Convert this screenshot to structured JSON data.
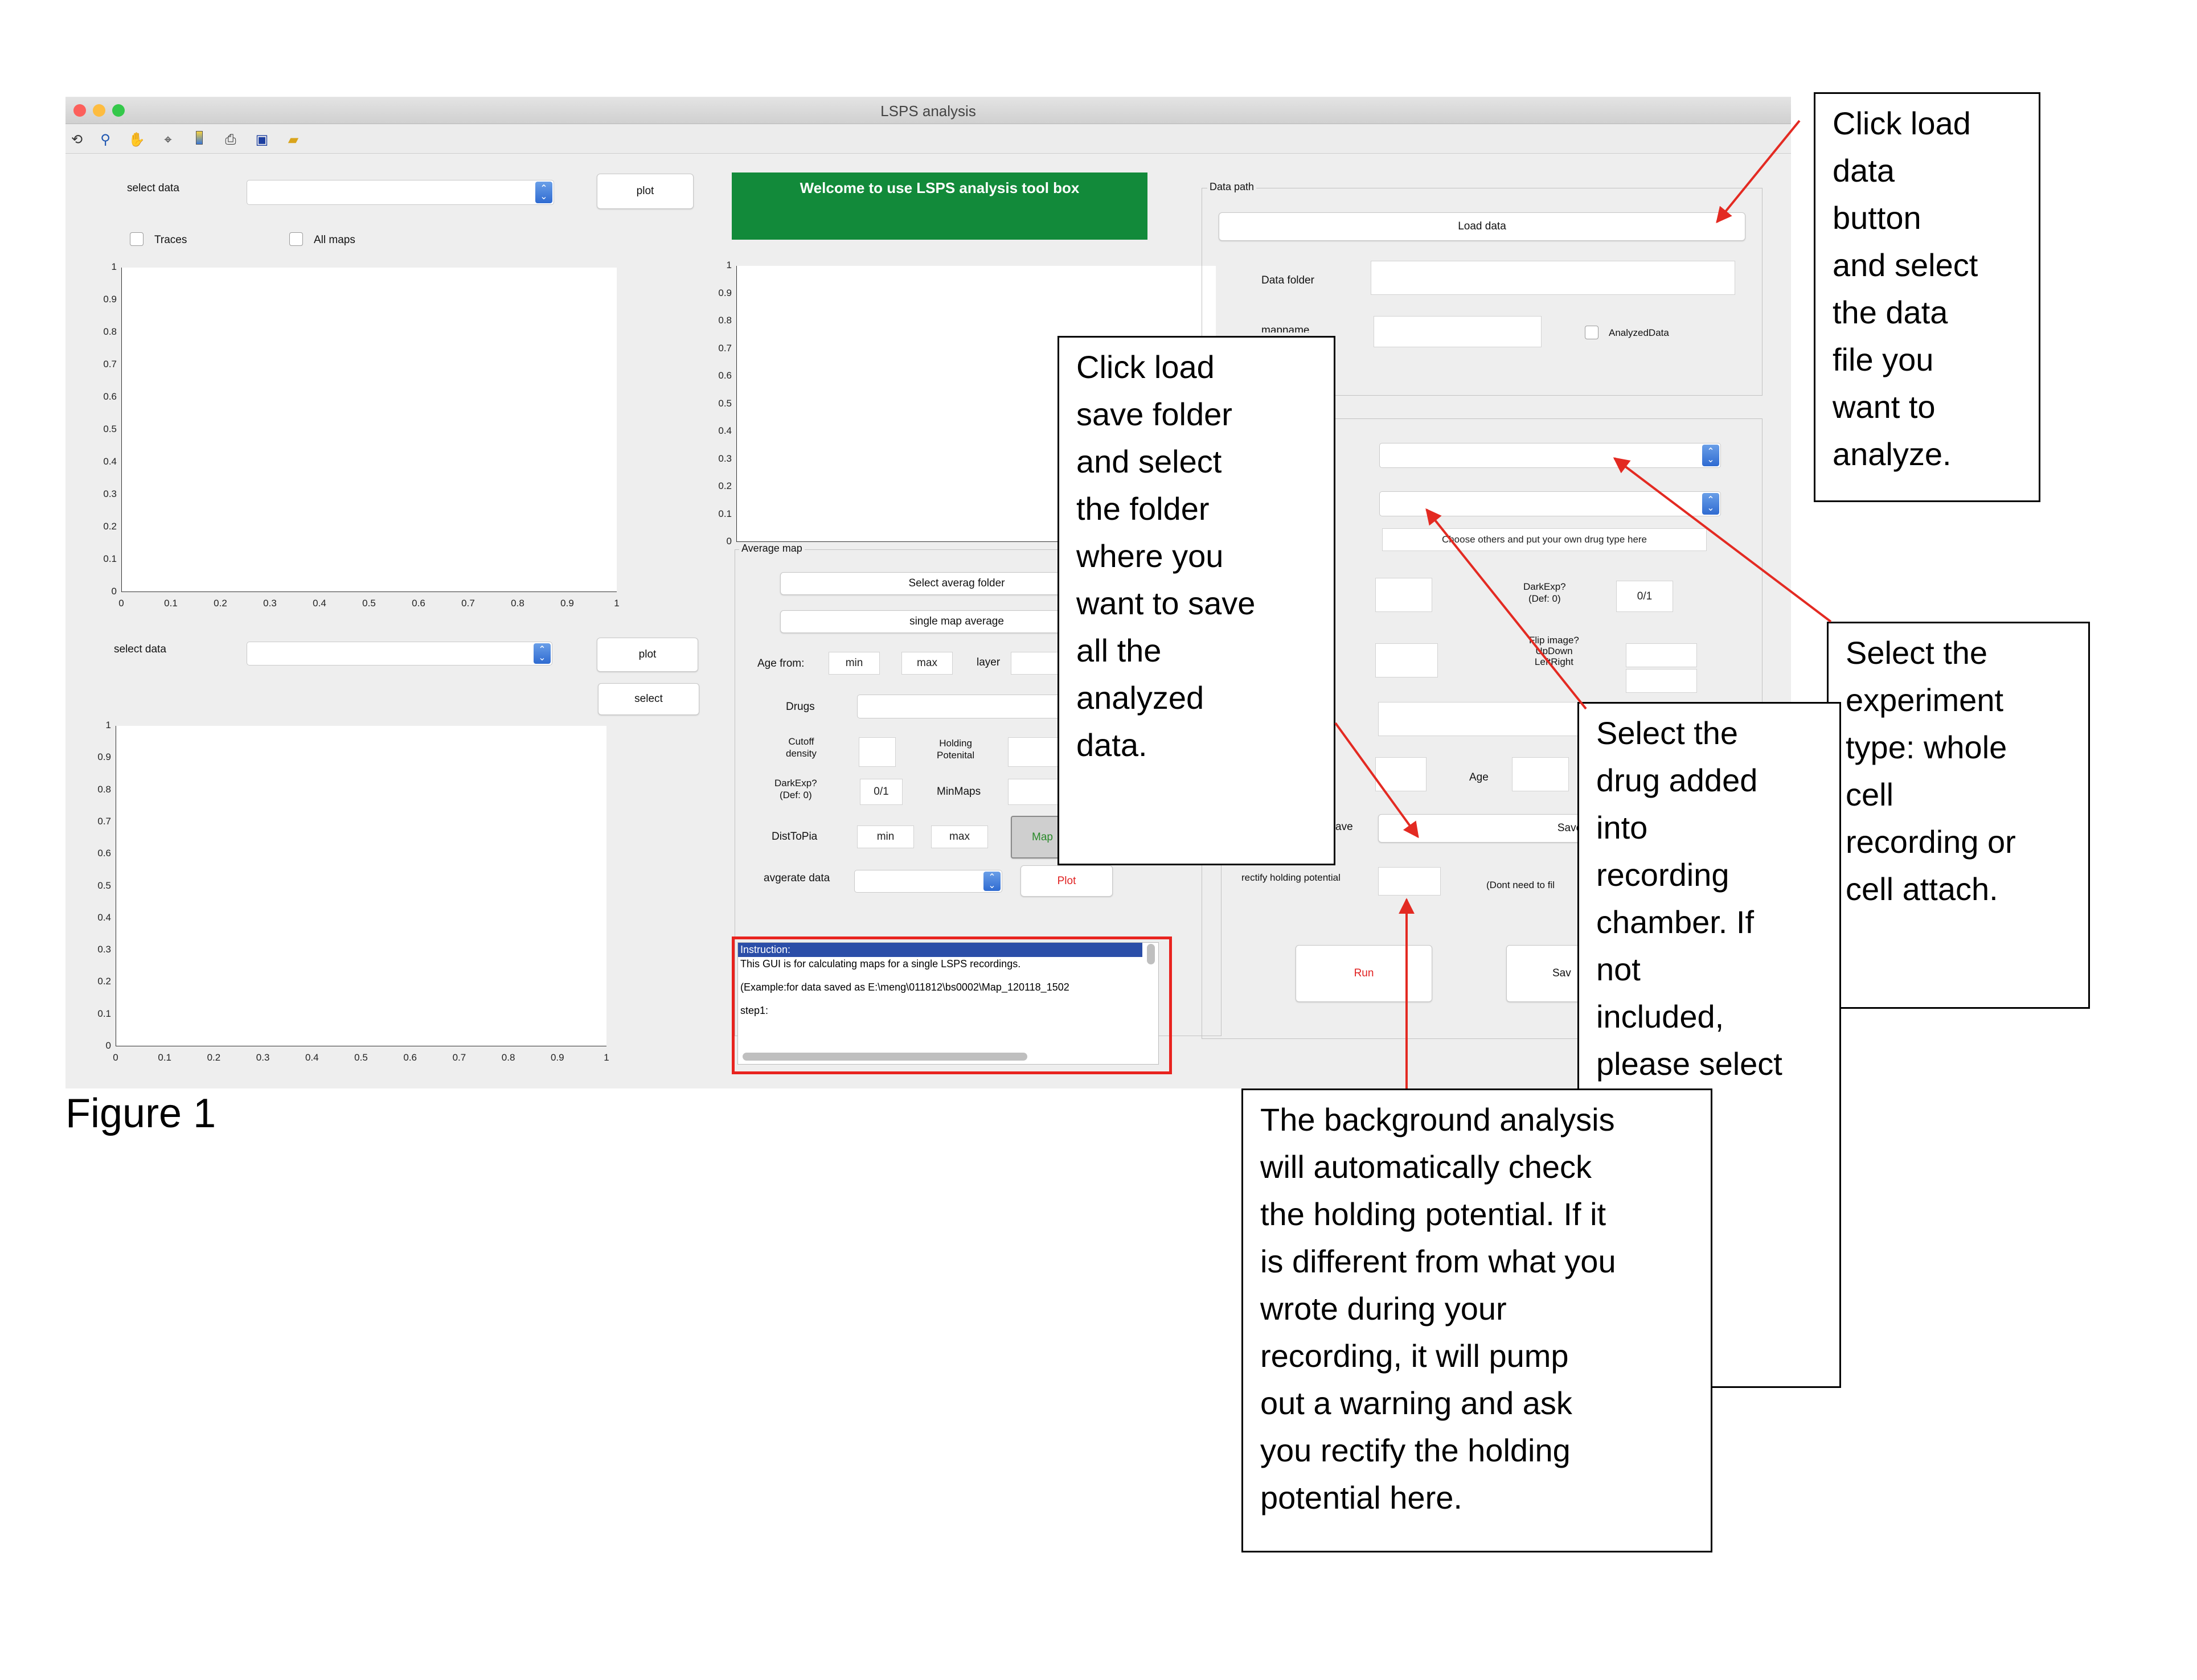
{
  "window": {
    "title": "LSPS analysis",
    "traffic_light_colors": [
      "#fc605c",
      "#fdbc40",
      "#34c84a"
    ]
  },
  "toolbar": {
    "icons": [
      "rotate-icon",
      "zoom-icon",
      "pan-hand-icon",
      "data-cursor-icon",
      "colorbar-icon",
      "print-icon",
      "save-icon",
      "open-folder-icon"
    ]
  },
  "left_panel": {
    "select_data_label": "select data",
    "plot_label": "plot",
    "traces_label": "Traces",
    "all_maps_label": "All maps",
    "select_data_label_2": "select data",
    "plot_label_2": "plot",
    "select_label": "select"
  },
  "axes_ticks": {
    "y": [
      "1",
      "0.9",
      "0.8",
      "0.7",
      "0.6",
      "0.5",
      "0.4",
      "0.3",
      "0.2",
      "0.1",
      "0"
    ],
    "x": [
      "0",
      "0.1",
      "0.2",
      "0.3",
      "0.4",
      "0.5",
      "0.6",
      "0.7",
      "0.8",
      "0.9",
      "1"
    ]
  },
  "banner": {
    "text": "Welcome to use LSPS analysis tool box",
    "color": "#128a3a"
  },
  "average_map": {
    "title": "Average map",
    "select_folder_label": "Select averag folder",
    "single_map_label": "single map average",
    "age_from_label": "Age from:",
    "min_placeholder": "min",
    "max_placeholder": "max",
    "layer_label": "layer",
    "drugs_label": "Drugs",
    "cutoff_label": "Cutoff\ndensity",
    "holding_label": "Holding\nPotenital",
    "darkexp_label": "DarkExp?\n(Def: 0)",
    "darkexp_value": "0/1",
    "minmaps_label": "MinMaps",
    "disttopia_label": "DistToPia",
    "dist_min": "min",
    "dist_max": "max",
    "map_button": "Map",
    "avg_data_label": "avgerate data",
    "plot_button": "Plot"
  },
  "instruction_box": {
    "selected_line": "Instruction:",
    "lines": [
      "This GUI is for calculating maps for a single LSPS recordings.",
      "(Example:for data saved as E:\\meng\\011812\\bs0002\\Map_120118_1502",
      "step1:"
    ],
    "highlight_color": "#e8231f"
  },
  "data_path": {
    "title": "Data path",
    "load_data_label": "Load data",
    "data_folder_label": "Data folder",
    "mapname_label": "mapname",
    "analyzed_label": "AnalyzedData"
  },
  "settings": {
    "drug_hint": "Choose others and put your own drug type here",
    "darkexp_label": "DarkExp?\n(Def: 0)",
    "darkexp_value": "0/1",
    "flip_label": "Flip image?\nUpDown\nLeftRight",
    "age_label": "Age",
    "save_label_partial": "ave",
    "save_folder_label": "Save folder",
    "rectify_label": "rectify holding potential",
    "dont_need_label": "(Dont need to fil",
    "run_label": "Run",
    "save_partial": "Sav"
  },
  "callouts": {
    "load_data": "Click load\ndata\nbutton\nand select\nthe data\nfile you\nwant to\nanalyze.",
    "save_folder": "Click load\nsave folder\nand select\nthe folder\nwhere you\nwant to save\nall the\nanalyzed\ndata.",
    "experiment_type": "Select the\nexperiment\ntype: whole\ncell\nrecording or\ncell attach.",
    "drug": "Select the\ndrug added\ninto\nrecording\nchamber. If\nnot\nincluded,\nplease select\n               and\n               he\n               ame\n               text\n               low",
    "holding": "The background analysis\nwill automatically  check\nthe holding potential. If it\nis different from what you\nwrote during your\nrecording, it will pump\nout a warning and ask\nyou rectify the holding\npotential here."
  },
  "caption": "Figure 1",
  "arrow_color": "#e32a22"
}
